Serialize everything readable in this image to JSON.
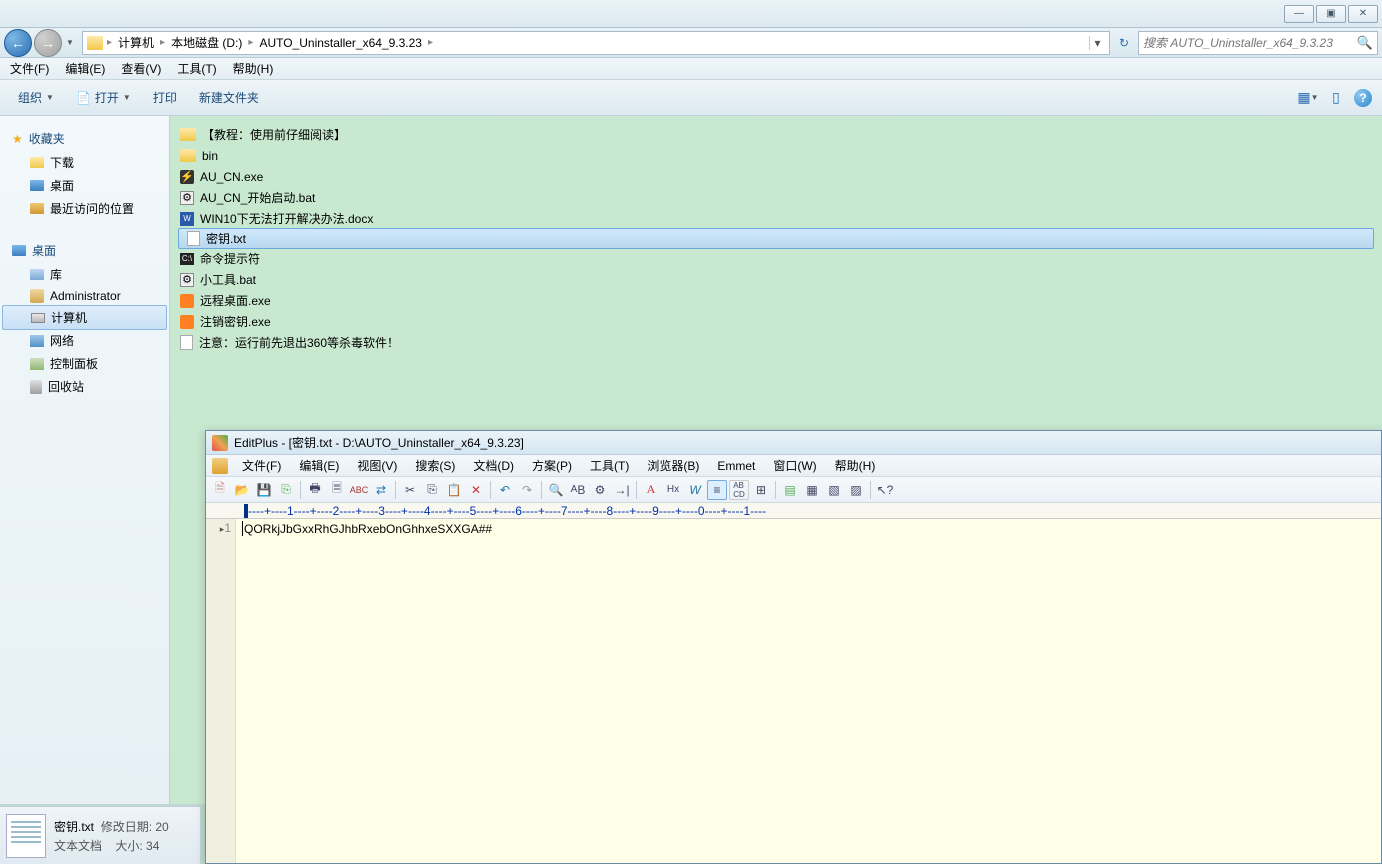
{
  "window_controls": {
    "min": "—",
    "max": "▣",
    "close": "✕"
  },
  "breadcrumb": {
    "items": [
      "计算机",
      "本地磁盘 (D:)",
      "AUTO_Uninstaller_x64_9.3.23"
    ]
  },
  "search": {
    "placeholder": "搜索 AUTO_Uninstaller_x64_9.3.23"
  },
  "menubar": [
    "文件(F)",
    "编辑(E)",
    "查看(V)",
    "工具(T)",
    "帮助(H)"
  ],
  "toolbar": {
    "organize": "组织",
    "open": "打开",
    "print": "打印",
    "newfolder": "新建文件夹"
  },
  "sidebar": {
    "favorites": {
      "label": "收藏夹",
      "items": [
        "下载",
        "桌面",
        "最近访问的位置"
      ]
    },
    "desktop": {
      "label": "桌面",
      "items": [
        "库",
        "Administrator",
        "计算机",
        "网络",
        "控制面板",
        "回收站"
      ]
    }
  },
  "files": [
    {
      "name": "【教程：使用前仔细阅读】",
      "type": "folder"
    },
    {
      "name": "bin",
      "type": "folder"
    },
    {
      "name": "AU_CN.exe",
      "type": "exe"
    },
    {
      "name": "AU_CN_开始启动.bat",
      "type": "bat"
    },
    {
      "name": "WIN10下无法打开解决办法.docx",
      "type": "docx"
    },
    {
      "name": "密钥.txt",
      "type": "txt",
      "selected": true
    },
    {
      "name": "命令提示符",
      "type": "cmd"
    },
    {
      "name": "小工具.bat",
      "type": "bat"
    },
    {
      "name": "远程桌面.exe",
      "type": "orange"
    },
    {
      "name": "注销密钥.exe",
      "type": "orange"
    },
    {
      "name": "注意：运行前先退出360等杀毒软件！",
      "type": "txt"
    }
  ],
  "status": {
    "filename": "密钥.txt",
    "modlabel": "修改日期: 20",
    "type": "文本文档",
    "sizelabel": "大小: 34"
  },
  "editplus": {
    "title": "EditPlus - [密钥.txt - D:\\AUTO_Uninstaller_x64_9.3.23]",
    "menubar": [
      "文件(F)",
      "编辑(E)",
      "视图(V)",
      "搜索(S)",
      "文档(D)",
      "方案(P)",
      "工具(T)",
      "浏览器(B)",
      "Emmet",
      "窗口(W)",
      "帮助(H)"
    ],
    "ruler": "----+----1----+----2----+----3----+----4----+----5----+----6----+----7----+----8----+----9----+----0----+----1----",
    "line_no": "1",
    "content": "QORkjJbGxxRhGJhbRxebOnGhhxeSXXGA##"
  }
}
